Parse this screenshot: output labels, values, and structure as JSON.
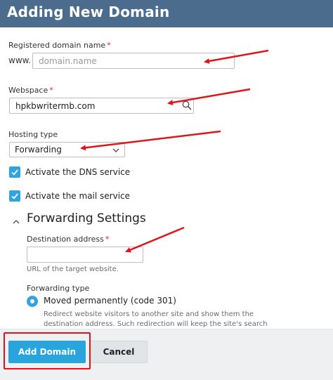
{
  "header": {
    "title": "Adding New Domain"
  },
  "domain_name": {
    "label": "Registered domain name",
    "required_mark": "*",
    "prefix": "www.",
    "placeholder": "domain.name",
    "value": ""
  },
  "webspace": {
    "label": "Webspace",
    "required_mark": "*",
    "value": "hpkbwritermb.com",
    "search_icon": "search-icon"
  },
  "hosting_type": {
    "label": "Hosting type",
    "selected": "Forwarding"
  },
  "options": {
    "dns": {
      "label": "Activate the DNS service",
      "checked": true
    },
    "mail": {
      "label": "Activate the mail service",
      "checked": true
    }
  },
  "forwarding": {
    "section_title": "Forwarding Settings",
    "collapse_icon": "chevron-up-icon",
    "destination": {
      "label": "Destination address",
      "required_mark": "*",
      "value": "",
      "hint": "URL of the target website."
    },
    "type": {
      "label": "Forwarding type",
      "selected_option": "Moved permanently (code 301)",
      "description": "Redirect website visitors to another site and show them the destination address. Such redirection will keep the site's search engine rankings."
    }
  },
  "footer": {
    "primary_button": "Add Domain",
    "secondary_button": "Cancel"
  },
  "colors": {
    "header_bg": "#4b6c8d",
    "accent": "#28a5df",
    "annotation_red": "#e0151c"
  }
}
